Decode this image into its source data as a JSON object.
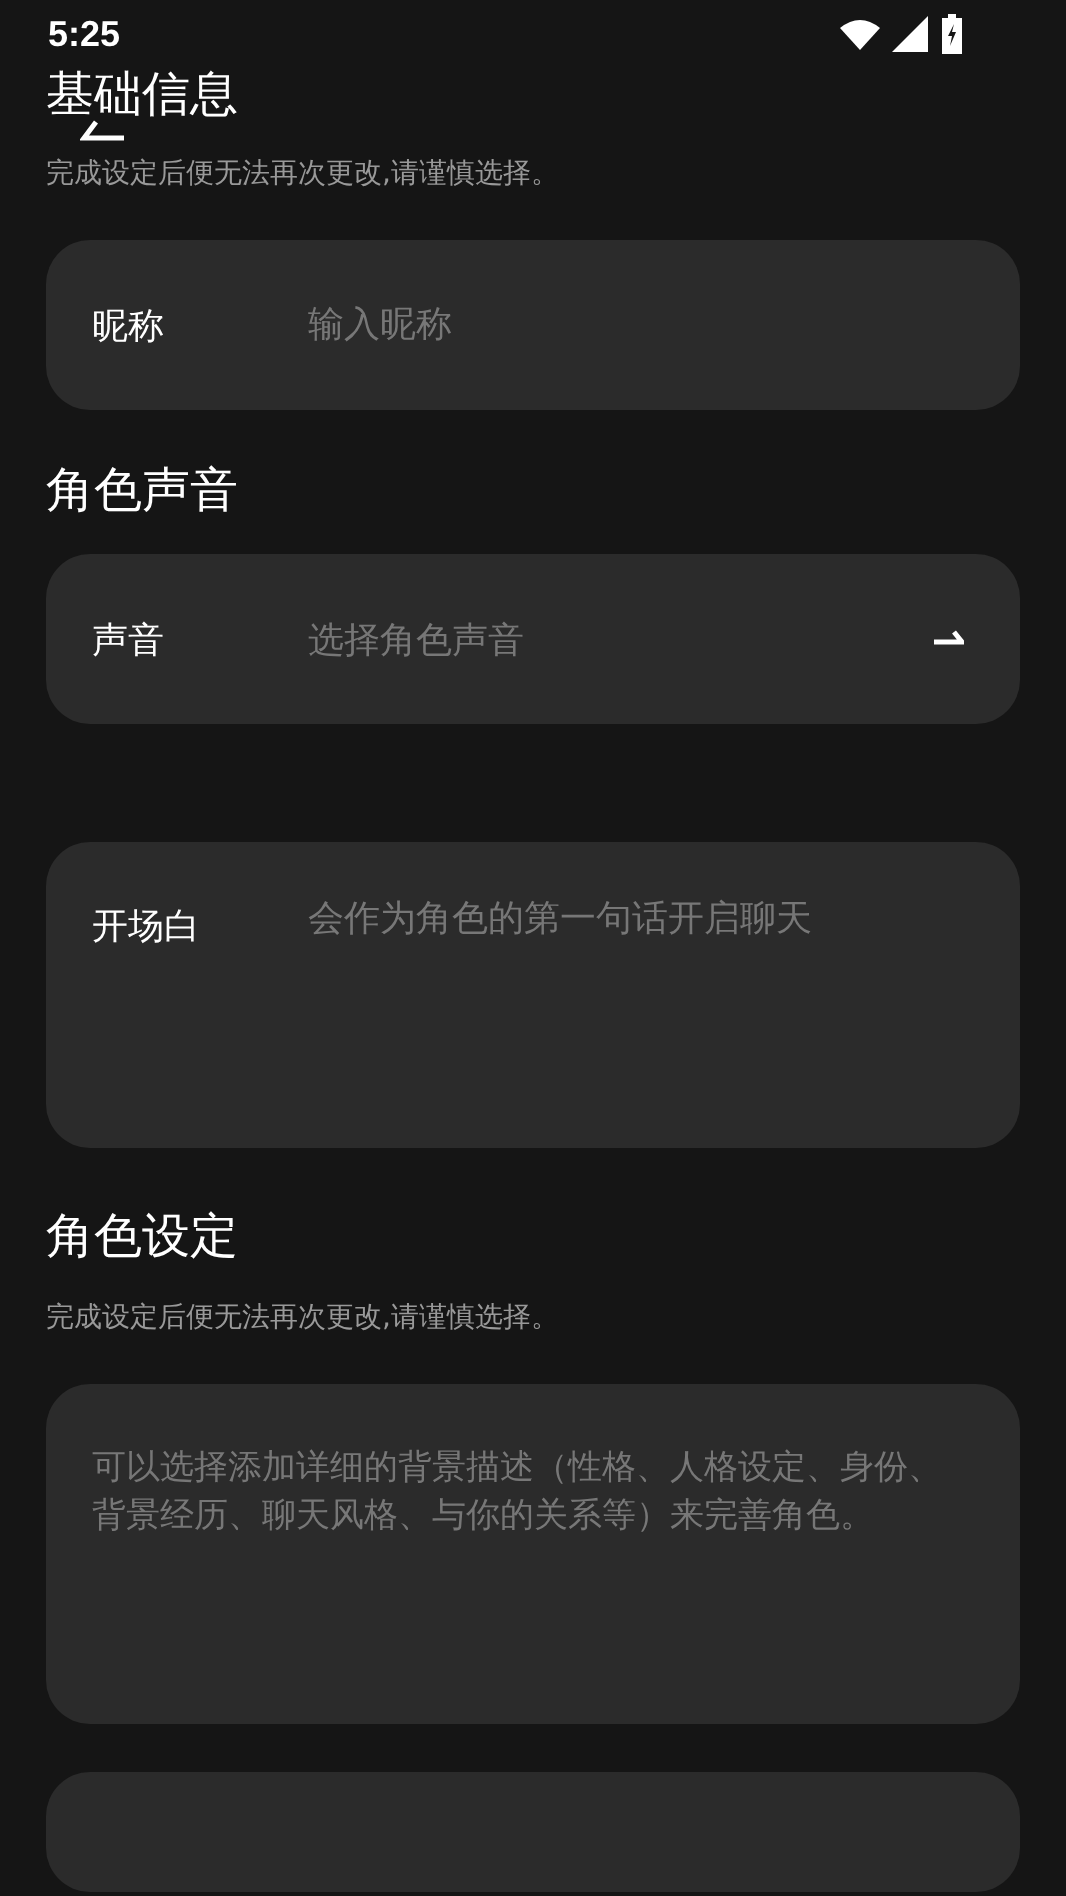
{
  "status_bar": {
    "time": "5:25"
  },
  "basic_info": {
    "title": "基础信息",
    "subtitle": "完成设定后便无法再次更改,请谨慎选择。",
    "nickname": {
      "label": "昵称",
      "placeholder": "输入昵称"
    }
  },
  "voice_section": {
    "title": "角色声音",
    "voice": {
      "label": "声音",
      "placeholder": "选择角色声音"
    },
    "opening": {
      "label": "开场白",
      "placeholder": "会作为角色的第一句话开启聊天"
    }
  },
  "role_settings": {
    "title": "角色设定",
    "subtitle": "完成设定后便无法再次更改,请谨慎选择。",
    "background": {
      "placeholder": "可以选择添加详细的背景描述（性格、人格设定、身份、背景经历、聊天风格、与你的关系等）来完善角色。"
    }
  }
}
